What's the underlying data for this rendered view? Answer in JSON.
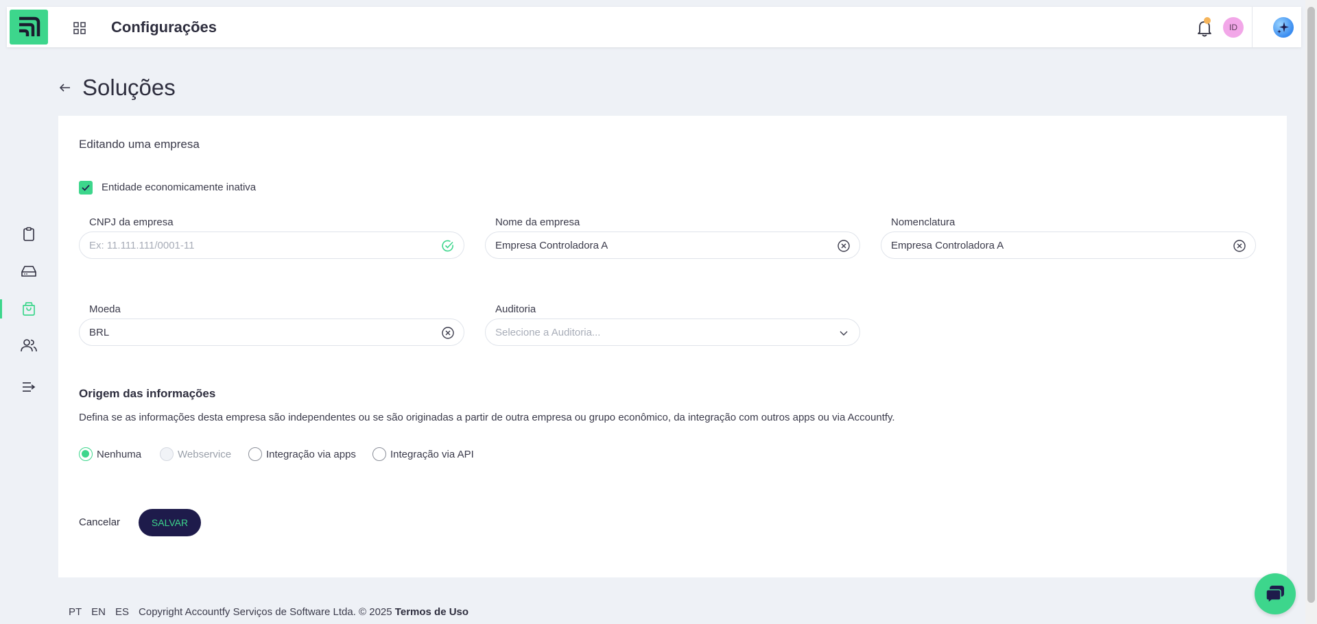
{
  "topbar": {
    "title": "Configurações",
    "avatar_initials": "ID"
  },
  "page": {
    "title": "Soluções"
  },
  "form": {
    "subtitle": "Editando uma empresa",
    "checkbox_label": "Entidade economicamente inativa",
    "checkbox_checked": true,
    "cnpj": {
      "label": "CNPJ da empresa",
      "placeholder": "Ex: 11.111.111/0001-11",
      "value": ""
    },
    "nome": {
      "label": "Nome da empresa",
      "value": "Empresa Controladora A"
    },
    "nomenclatura": {
      "label": "Nomenclatura",
      "value": "Empresa Controladora A"
    },
    "moeda": {
      "label": "Moeda",
      "value": "BRL"
    },
    "auditoria": {
      "label": "Auditoria",
      "placeholder": "Selecione a Auditoria..."
    },
    "origem": {
      "title": "Origem das informações",
      "description": "Defina se as informações desta empresa são independentes ou se são originadas a partir de outra empresa ou grupo econômico, da integração com outros apps ou via Accountfy.",
      "options": [
        {
          "label": "Nenhuma",
          "selected": true,
          "disabled": false
        },
        {
          "label": "Webservice",
          "selected": false,
          "disabled": true
        },
        {
          "label": "Integração via apps",
          "selected": false,
          "disabled": false
        },
        {
          "label": "Integração via API",
          "selected": false,
          "disabled": false
        }
      ]
    },
    "cancel_label": "Cancelar",
    "save_label": "SALVAR"
  },
  "footer": {
    "languages": [
      "PT",
      "EN",
      "ES"
    ],
    "copyright": "Copyright Accountfy Serviços de Software Ltda. © 2025",
    "terms": "Termos de Uso"
  },
  "colors": {
    "accent": "#3dd68c",
    "primary_dark": "#1e1b4b",
    "background": "#eef1f6"
  },
  "icons": {
    "sidebar": [
      "clipboard-icon",
      "drive-icon",
      "shopping-bag-icon",
      "users-icon",
      "collapse-menu-icon"
    ]
  }
}
